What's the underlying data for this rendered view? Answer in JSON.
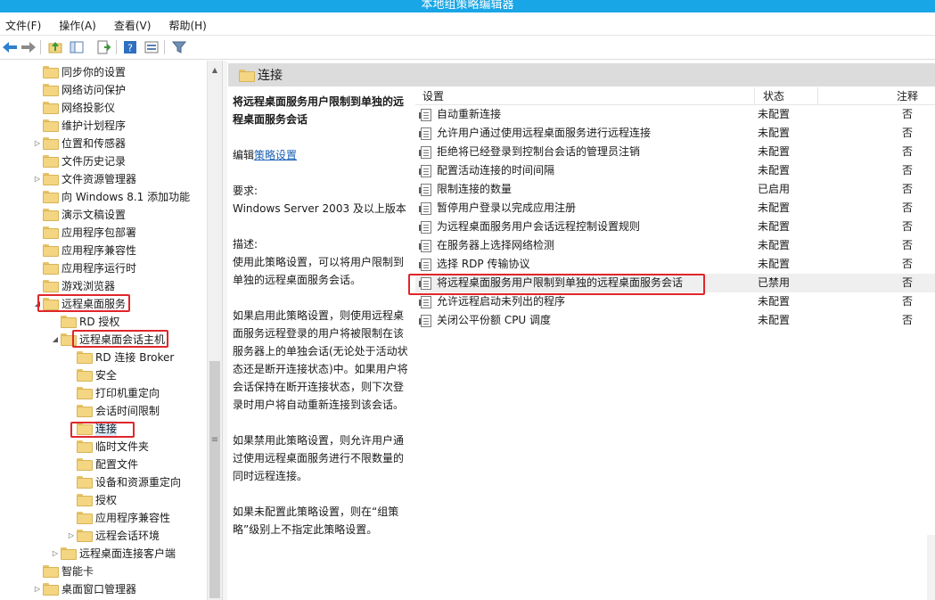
{
  "window": {
    "title": "本地组策略编辑器"
  },
  "menu": [
    "文件(F)",
    "操作(A)",
    "查看(V)",
    "帮助(H)"
  ],
  "tree": [
    {
      "label": "同步你的设置",
      "level": 2,
      "expander": ""
    },
    {
      "label": "网络访问保护",
      "level": 2,
      "expander": ""
    },
    {
      "label": "网络投影仪",
      "level": 2,
      "expander": ""
    },
    {
      "label": "维护计划程序",
      "level": 2,
      "expander": ""
    },
    {
      "label": "位置和传感器",
      "level": 2,
      "expander": "▷"
    },
    {
      "label": "文件历史记录",
      "level": 2,
      "expander": ""
    },
    {
      "label": "文件资源管理器",
      "level": 2,
      "expander": "▷"
    },
    {
      "label": "向 Windows 8.1 添加功能",
      "level": 2,
      "expander": ""
    },
    {
      "label": "演示文稿设置",
      "level": 2,
      "expander": ""
    },
    {
      "label": "应用程序包部署",
      "level": 2,
      "expander": ""
    },
    {
      "label": "应用程序兼容性",
      "level": 2,
      "expander": ""
    },
    {
      "label": "应用程序运行时",
      "level": 2,
      "expander": ""
    },
    {
      "label": "游戏浏览器",
      "level": 2,
      "expander": ""
    },
    {
      "label": "远程桌面服务",
      "level": 2,
      "expander": "◢"
    },
    {
      "label": "RD 授权",
      "level": 3,
      "expander": ""
    },
    {
      "label": "远程桌面会话主机",
      "level": 3,
      "expander": "◢"
    },
    {
      "label": "RD 连接 Broker",
      "level": 4,
      "expander": ""
    },
    {
      "label": "安全",
      "level": 4,
      "expander": ""
    },
    {
      "label": "打印机重定向",
      "level": 4,
      "expander": ""
    },
    {
      "label": "会话时间限制",
      "level": 4,
      "expander": ""
    },
    {
      "label": "连接",
      "level": 4,
      "expander": "",
      "selected": true
    },
    {
      "label": "临时文件夹",
      "level": 4,
      "expander": ""
    },
    {
      "label": "配置文件",
      "level": 4,
      "expander": ""
    },
    {
      "label": "设备和资源重定向",
      "level": 4,
      "expander": ""
    },
    {
      "label": "授权",
      "level": 4,
      "expander": ""
    },
    {
      "label": "应用程序兼容性",
      "level": 4,
      "expander": ""
    },
    {
      "label": "远程会话环境",
      "level": 4,
      "expander": "▷"
    },
    {
      "label": "远程桌面连接客户端",
      "level": 3,
      "expander": "▷"
    },
    {
      "label": "智能卡",
      "level": 2,
      "expander": ""
    },
    {
      "label": "桌面窗口管理器",
      "level": 2,
      "expander": "▷"
    }
  ],
  "content": {
    "header": "连接",
    "description": {
      "title": "将远程桌面服务用户限制到单独的远程桌面服务会话",
      "edit_prefix": "编辑",
      "edit_link": "策略设置",
      "req_label": "要求:",
      "req_value": "Windows Server 2003 及以上版本",
      "desc_label": "描述:",
      "para1": "使用此策略设置，可以将用户限制到单独的远程桌面服务会话。",
      "para2": "如果启用此策略设置，则使用远程桌面服务远程登录的用户将被限制在该服务器上的单独会话(无论处于活动状态还是断开连接状态)中。如果用户将会话保持在断开连接状态，则下次登录时用户将自动重新连接到该会话。",
      "para3": "如果禁用此策略设置，则允许用户通过使用远程桌面服务进行不限数量的同时远程连接。",
      "para4": "如果未配置此策略设置，则在“组策略”级别上不指定此策略设置。"
    },
    "columns": {
      "setting": "设置",
      "state": "状态",
      "comment": "注释"
    },
    "rows": [
      {
        "setting": "自动重新连接",
        "state": "未配置",
        "comment": "否"
      },
      {
        "setting": "允许用户通过使用远程桌面服务进行远程连接",
        "state": "未配置",
        "comment": "否"
      },
      {
        "setting": "拒绝将已经登录到控制台会话的管理员注销",
        "state": "未配置",
        "comment": "否"
      },
      {
        "setting": "配置活动连接的时间间隔",
        "state": "未配置",
        "comment": "否"
      },
      {
        "setting": "限制连接的数量",
        "state": "已启用",
        "comment": "否"
      },
      {
        "setting": "暂停用户登录以完成应用注册",
        "state": "未配置",
        "comment": "否"
      },
      {
        "setting": "为远程桌面服务用户会话远程控制设置规则",
        "state": "未配置",
        "comment": "否"
      },
      {
        "setting": "在服务器上选择网络检测",
        "state": "未配置",
        "comment": "否"
      },
      {
        "setting": "选择 RDP 传输协议",
        "state": "未配置",
        "comment": "否"
      },
      {
        "setting": "将远程桌面服务用户限制到单独的远程桌面服务会话",
        "state": "已禁用",
        "comment": "否",
        "highlighted": true
      },
      {
        "setting": "允许远程启动未列出的程序",
        "state": "未配置",
        "comment": "否"
      },
      {
        "setting": "关闭公平份额 CPU 调度",
        "state": "未配置",
        "comment": "否"
      }
    ]
  },
  "colors": {
    "titlebar": "#19a6e6",
    "highlight_box": "#e0262b",
    "link": "#1a5fb4",
    "header_bg": "#dcdcdc"
  }
}
